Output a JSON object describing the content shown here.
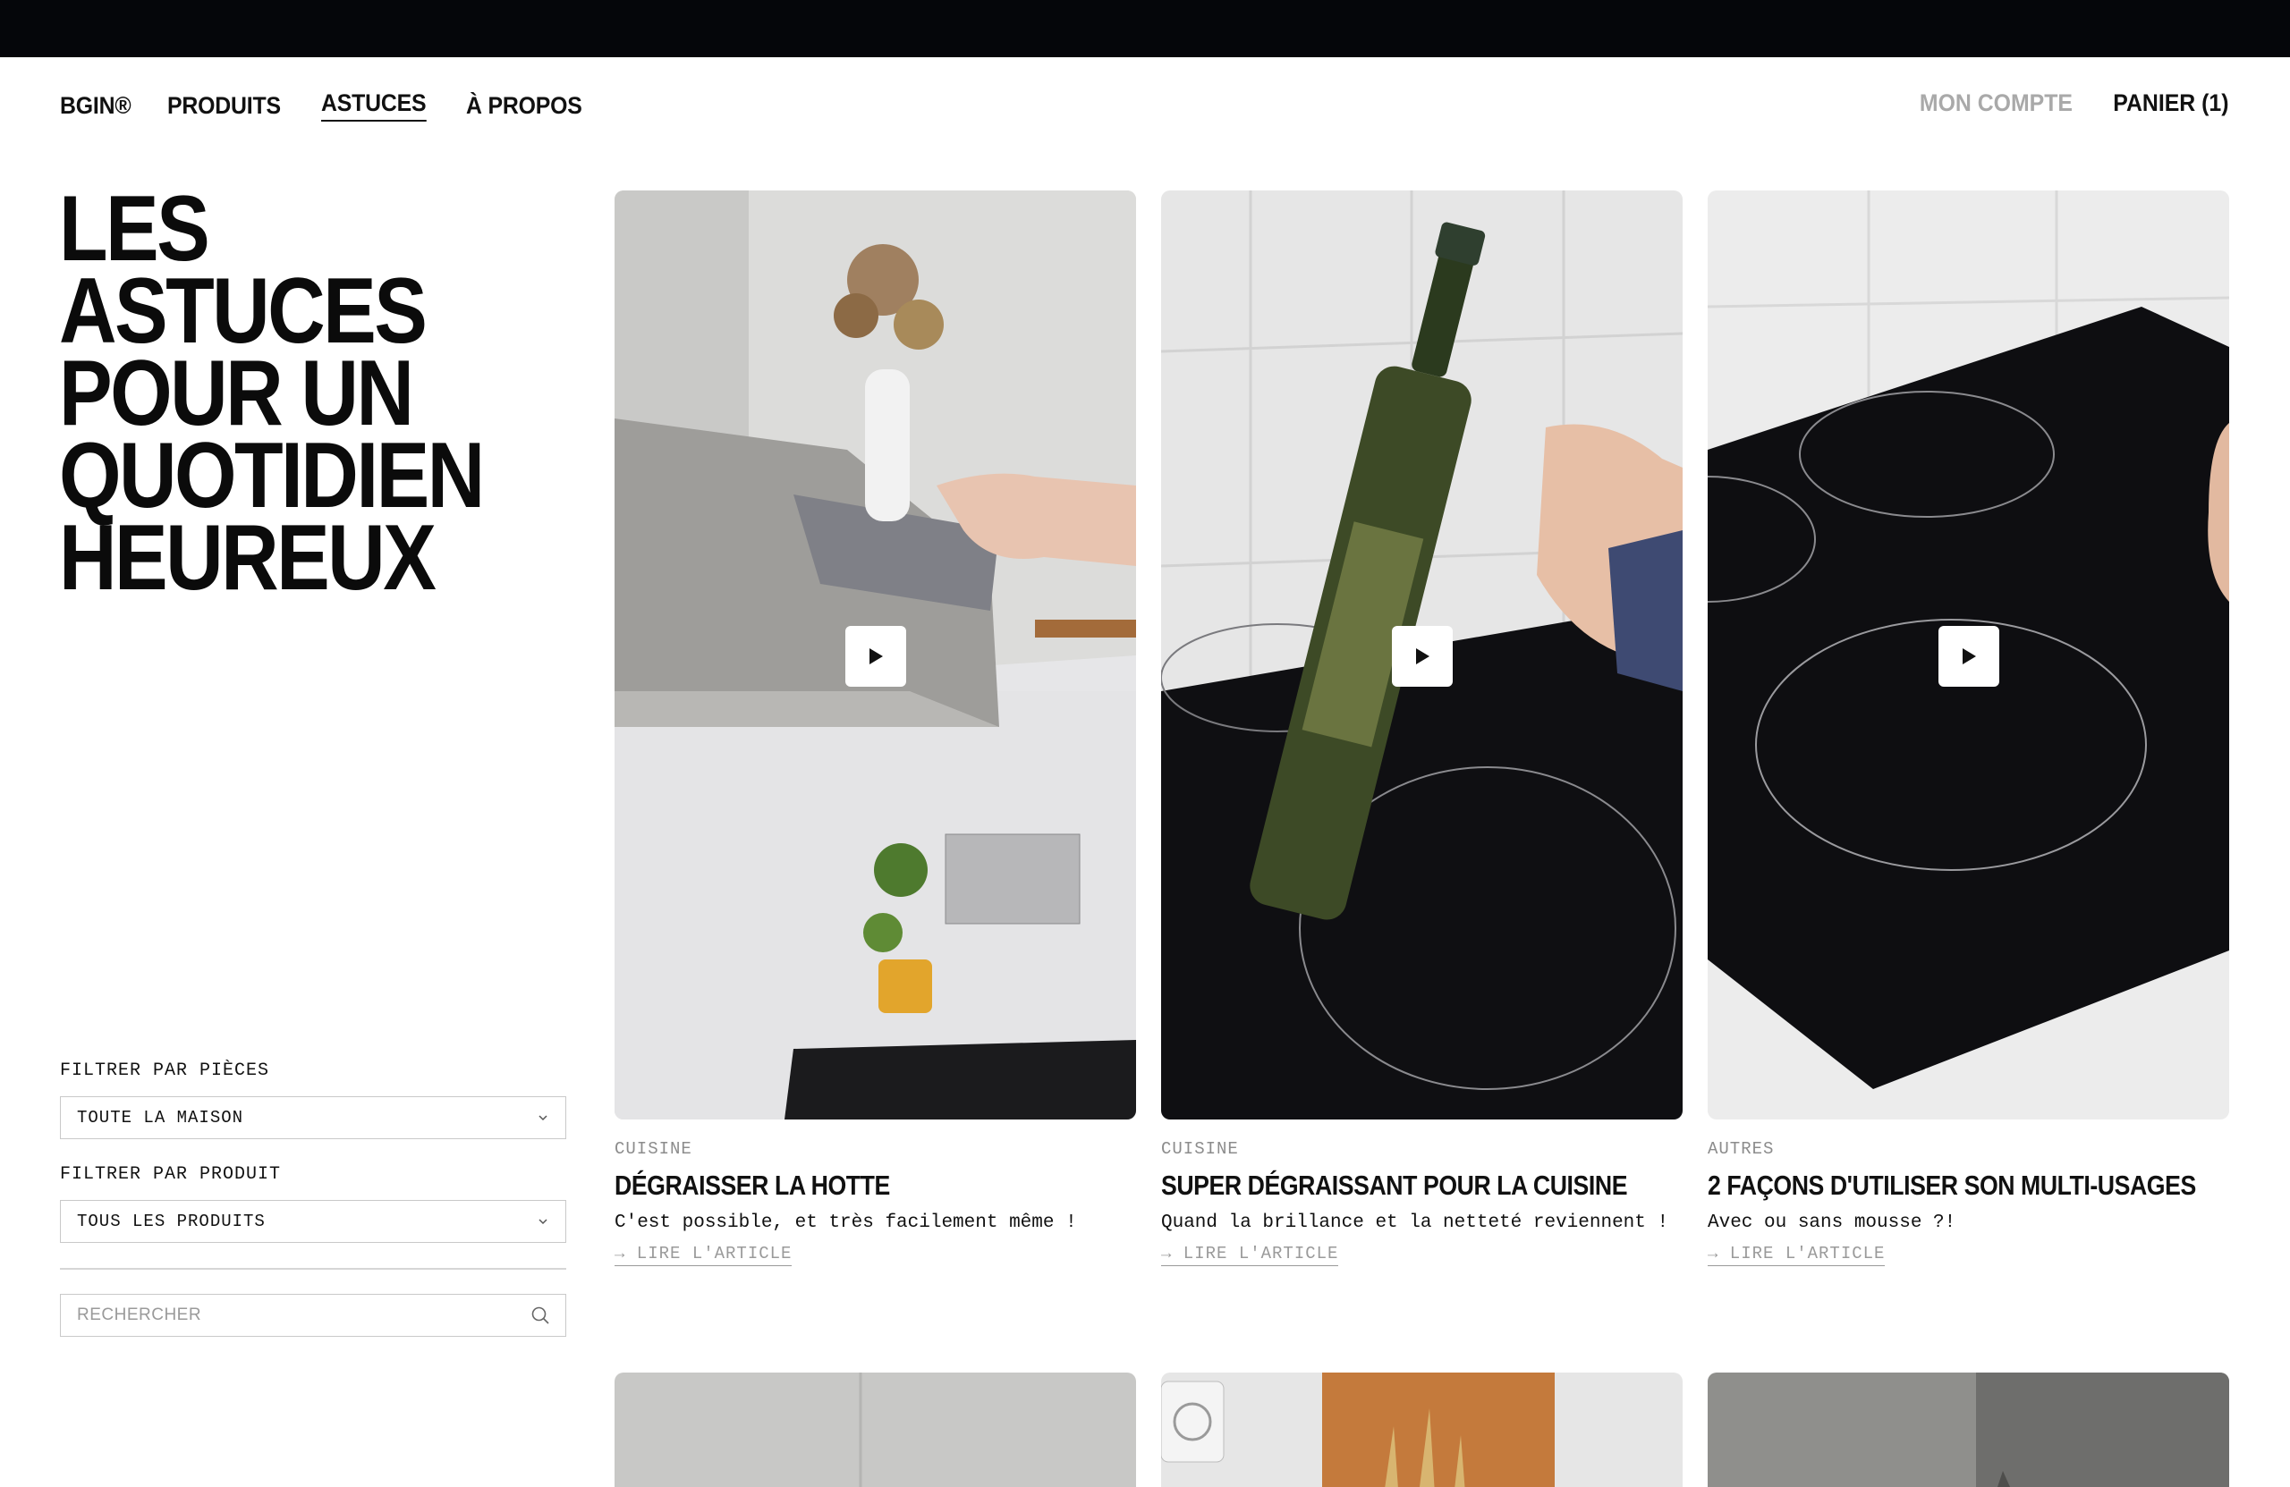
{
  "nav": {
    "brand": "BGIN®",
    "items": [
      {
        "label": "PRODUITS"
      },
      {
        "label": "ASTUCES"
      },
      {
        "label": "À PROPOS"
      }
    ],
    "account": "MON COMPTE",
    "cart": "PANIER (1)"
  },
  "hero": {
    "lines": [
      "LES ASTUCES",
      "POUR UN",
      "QUOTIDIEN",
      "HEUREUX"
    ]
  },
  "filters": {
    "rooms_label": "FILTRER PAR PIÈCES",
    "rooms_value": "TOUTE LA MAISON",
    "products_label": "FILTRER PAR PRODUIT",
    "products_value": "TOUS LES PRODUITS",
    "search_placeholder": "RECHERCHER"
  },
  "articles": [
    {
      "category": "CUISINE",
      "title": "DÉGRAISSER LA HOTTE",
      "excerpt": "C'est possible, et très facilement même !",
      "cta": "→ LIRE L'ARTICLE"
    },
    {
      "category": "CUISINE",
      "title": "SUPER DÉGRAISSANT POUR LA CUISINE",
      "excerpt": "Quand la brillance et la netteté reviennent !",
      "cta": "→ LIRE L'ARTICLE"
    },
    {
      "category": "AUTRES",
      "title": "2 FAÇONS D'UTILISER SON MULTI-USAGES",
      "excerpt": "Avec ou sans mousse ?!",
      "cta": "→ LIRE L'ARTICLE"
    }
  ],
  "icons": {
    "play": "play-icon",
    "chevron": "chevron-down-icon",
    "search": "search-icon"
  }
}
